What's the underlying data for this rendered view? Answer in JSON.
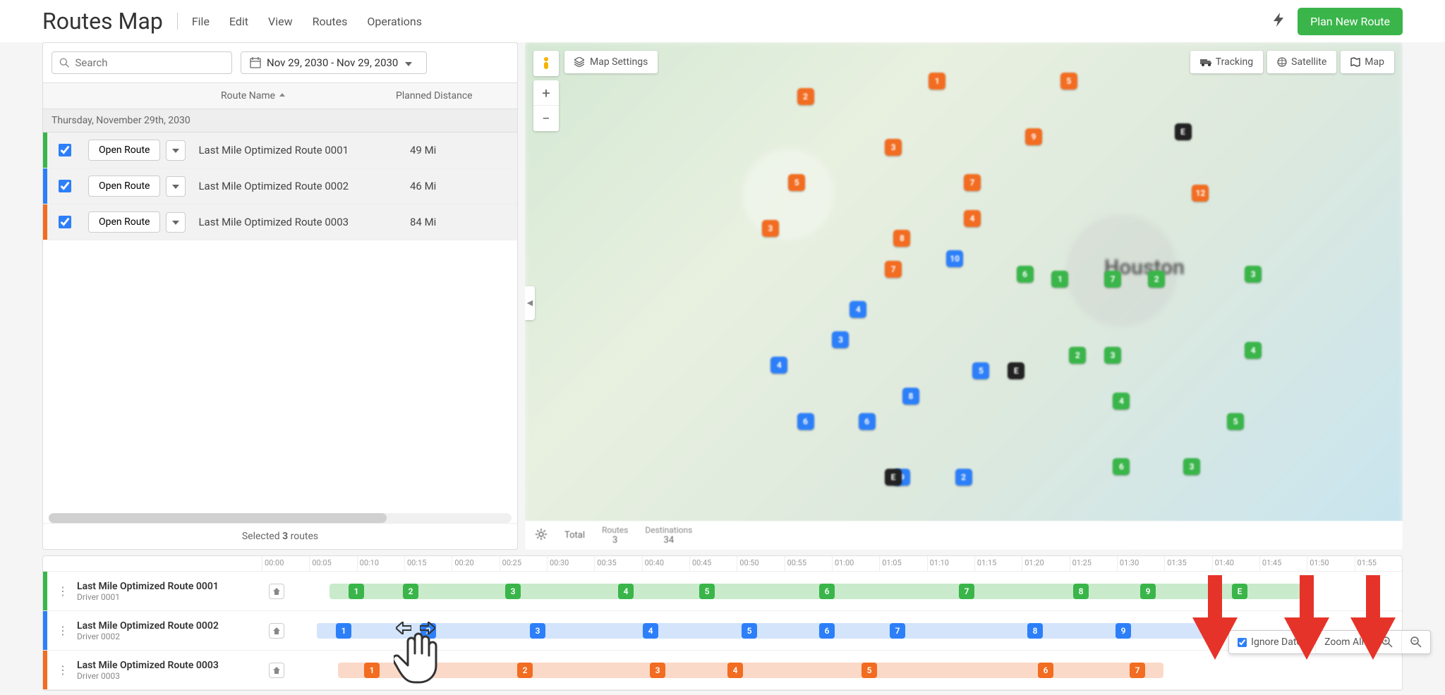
{
  "app": {
    "title": "Routes Map"
  },
  "menu": {
    "file": "File",
    "edit": "Edit",
    "view": "View",
    "routes": "Routes",
    "operations": "Operations"
  },
  "topbar": {
    "plan_new": "Plan New Route"
  },
  "search": {
    "placeholder": "Search"
  },
  "date_range": {
    "text": "Nov 29, 2030 - Nov 29, 2030"
  },
  "table": {
    "col_route_name": "Route Name",
    "col_planned_distance": "Planned Distance",
    "date_group": "Thursday, November 29th, 2030",
    "open_label": "Open Route",
    "rows": [
      {
        "name": "Last Mile Optimized Route 0001",
        "dist": "49 Mi",
        "color": "#3ab54a"
      },
      {
        "name": "Last Mile Optimized Route 0002",
        "dist": "46 Mi",
        "color": "#2d7ff9"
      },
      {
        "name": "Last Mile Optimized Route 0003",
        "dist": "84 Mi",
        "color": "#f26c21"
      }
    ],
    "selected_prefix": "Selected ",
    "selected_count": "3",
    "selected_suffix": " routes"
  },
  "map": {
    "settings": "Map Settings",
    "tracking": "Tracking",
    "satellite": "Satellite",
    "map": "Map",
    "city": "Houston",
    "total_label": "Total",
    "routes_label": "Routes",
    "routes_count": "3",
    "dest_label": "Destinations",
    "dest_count": "34"
  },
  "timeline": {
    "ticks": [
      "00:00",
      "00:05",
      "00:10",
      "00:15",
      "00:20",
      "00:25",
      "00:30",
      "00:35",
      "00:40",
      "00:45",
      "00:50",
      "00:55",
      "01:00",
      "01:05",
      "01:10",
      "01:15",
      "01:20",
      "01:25",
      "01:30",
      "01:35",
      "01:40",
      "01:45",
      "01:50",
      "01:55"
    ],
    "rows": [
      {
        "title": "Last Mile Optimized Route 0001",
        "driver": "Driver 0001",
        "color_stripe": "#3ab54a",
        "bar_color": "#c9eacb",
        "stop_color": "#3ab54a",
        "stops": [
          "1",
          "2",
          "3",
          "4",
          "5",
          "6",
          "7",
          "8",
          "9",
          "E"
        ]
      },
      {
        "title": "Last Mile Optimized Route 0002",
        "driver": "Driver 0002",
        "color_stripe": "#2d7ff9",
        "bar_color": "#d3e4fb",
        "stop_color": "#2d7ff9",
        "stops": [
          "1",
          "2",
          "3",
          "4",
          "5",
          "6",
          "7",
          "8",
          "9"
        ]
      },
      {
        "title": "Last Mile Optimized Route 0003",
        "driver": "Driver 0003",
        "color_stripe": "#f26c21",
        "bar_color": "#fbd9c8",
        "stop_color": "#f26c21",
        "stops": [
          "1",
          "2",
          "3",
          "4",
          "5",
          "6",
          "7"
        ]
      }
    ],
    "ignore_dates": "Ignore Dates",
    "zoom_all": "Zoom All"
  }
}
